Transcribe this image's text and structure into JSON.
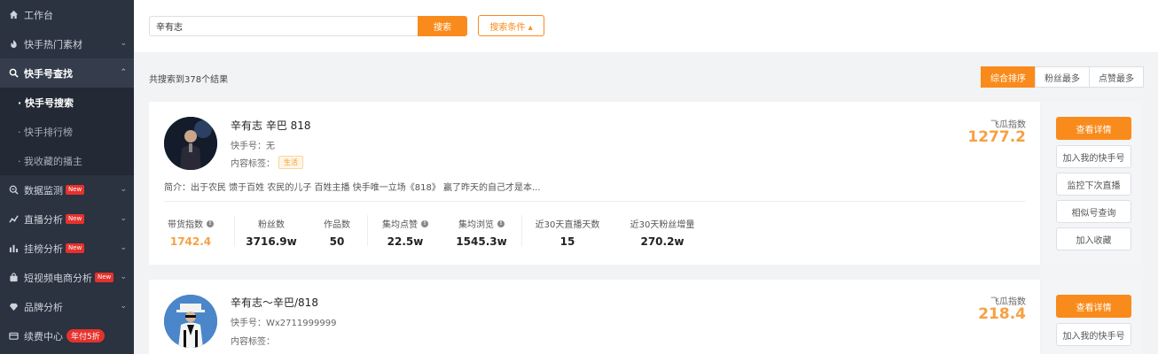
{
  "sidebar": {
    "items": [
      {
        "label": "工作台",
        "icon": "home-icon"
      },
      {
        "label": "快手热门素材",
        "icon": "fire-icon"
      },
      {
        "label": "快手号查找",
        "icon": "search-icon"
      },
      {
        "label": "数据监测",
        "icon": "monitor-icon",
        "badge": "New"
      },
      {
        "label": "直播分析",
        "icon": "live-chart-icon",
        "badge": "New"
      },
      {
        "label": "挂榜分析",
        "icon": "bar-chart-icon",
        "badge": "New"
      },
      {
        "label": "短视频电商分析",
        "icon": "shopping-bag-icon",
        "badge": "New"
      },
      {
        "label": "品牌分析",
        "icon": "diamond-icon"
      },
      {
        "label": "续费中心",
        "icon": "card-icon",
        "promo": "年付5折"
      }
    ],
    "subitems": [
      "· 快手号搜索",
      "· 快手排行榜",
      "· 我收藏的播主"
    ]
  },
  "search": {
    "value": "辛有志",
    "button": "搜索",
    "conditions": "搜索条件 ▴"
  },
  "results": {
    "count_text": "共搜索到378个结果",
    "sort": [
      "综合排序",
      "粉丝最多",
      "点赞最多"
    ]
  },
  "metric_labels": [
    "带货指数",
    "粉丝数",
    "作品数",
    "集均点赞",
    "集均浏览",
    "近30天直播天数",
    "近30天粉丝增量"
  ],
  "fg_label": "飞瓜指数",
  "actions": [
    "查看详情",
    "加入我的快手号",
    "监控下次直播",
    "相似号查询",
    "加入收藏"
  ],
  "cards": [
    {
      "name": "辛有志 辛巴 818",
      "kid": "快手号：无",
      "tags_label": "内容标签：",
      "tag": "生活",
      "intro": "简介：出于农民 馈于百姓 农民的儿子 百姓主播 快手唯一立场《818》 赢了昨天的自己才是本...",
      "fg_value": "1277.2",
      "metrics": [
        "1742.4",
        "3716.9w",
        "50",
        "22.5w",
        "1545.3w",
        "15",
        "270.2w"
      ]
    },
    {
      "name": "辛有志～辛巴/818",
      "kid": "快手号：Wx2711999999",
      "tags_label": "内容标签：",
      "fg_value": "218.4"
    }
  ]
}
